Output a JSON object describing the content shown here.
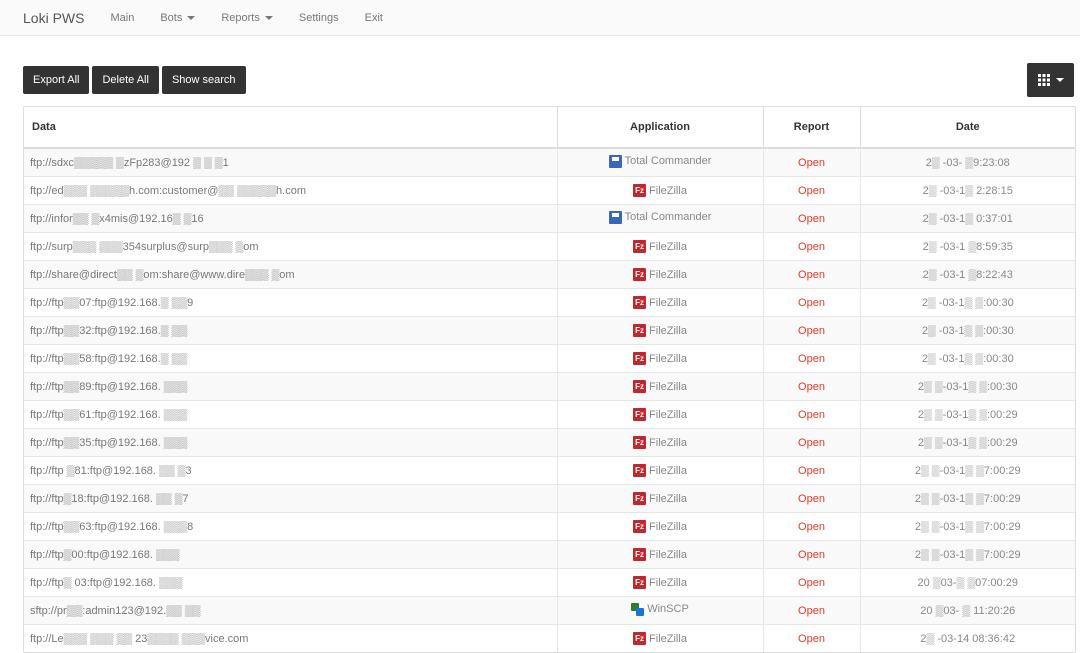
{
  "nav": {
    "brand": "Loki PWS",
    "items": [
      {
        "label": "Main",
        "dropdown": false
      },
      {
        "label": "Bots",
        "dropdown": true
      },
      {
        "label": "Reports",
        "dropdown": true
      },
      {
        "label": "Settings",
        "dropdown": false
      },
      {
        "label": "Exit",
        "dropdown": false
      }
    ]
  },
  "toolbar": {
    "export_all": "Export All",
    "delete_all": "Delete All",
    "show_search": "Show search"
  },
  "grid_button": {
    "icon": "grid-icon"
  },
  "table": {
    "headers": {
      "data": "Data",
      "application": "Application",
      "report": "Report",
      "date": "Date"
    },
    "report_link": "Open",
    "rows": [
      {
        "data": "ftp://sdxc▒▒▒▒▒ ▒zFp283@192 ▒ ▒ ▒1",
        "app": "Total Commander",
        "icon": "total-commander",
        "date": "2▒ -03- ▒9:23:08"
      },
      {
        "data": "ftp://ed▒▒▒ ▒▒▒▒▒h.com:customer@▒▒ ▒▒▒▒▒h.com",
        "app": "FileZilla",
        "icon": "filezilla",
        "date": "2▒ -03-1▒ 2:28:15"
      },
      {
        "data": "ftp://infor▒▒ ▒x4mis@192.16▒ ▒16",
        "app": "Total Commander",
        "icon": "total-commander",
        "date": "2▒ -03-1▒ 0:37:01"
      },
      {
        "data": "ftp://surp▒▒▒ ▒▒▒354surplus@surp▒▒▒ ▒om",
        "app": "FileZilla",
        "icon": "filezilla",
        "date": "2▒ -03-1 ▒8:59:35"
      },
      {
        "data": "ftp://share@direct▒▒ ▒om:share@www.dire▒▒▒ ▒om",
        "app": "FileZilla",
        "icon": "filezilla",
        "date": "2▒ -03-1 ▒8:22:43"
      },
      {
        "data": "ftp://ftp▒▒07:ftp@192.168.▒ ▒▒9",
        "app": "FileZilla",
        "icon": "filezilla",
        "date": "2▒ -03-1▒ ▒:00:30"
      },
      {
        "data": "ftp://ftp▒▒32:ftp@192.168.▒ ▒▒",
        "app": "FileZilla",
        "icon": "filezilla",
        "date": "2▒ -03-1▒ ▒:00:30"
      },
      {
        "data": "ftp://ftp▒▒58:ftp@192.168.▒ ▒▒",
        "app": "FileZilla",
        "icon": "filezilla",
        "date": "2▒ -03-1▒ ▒:00:30"
      },
      {
        "data": "ftp://ftp▒▒89:ftp@192.168. ▒▒▒",
        "app": "FileZilla",
        "icon": "filezilla",
        "date": "2▒ ▒-03-1▒ ▒:00:30"
      },
      {
        "data": "ftp://ftp▒▒61:ftp@192.168. ▒▒▒",
        "app": "FileZilla",
        "icon": "filezilla",
        "date": "2▒ ▒-03-1▒ ▒:00:29"
      },
      {
        "data": "ftp://ftp▒▒35:ftp@192.168. ▒▒▒",
        "app": "FileZilla",
        "icon": "filezilla",
        "date": "2▒ ▒-03-1▒ ▒:00:29"
      },
      {
        "data": "ftp://ftp ▒81:ftp@192.168. ▒▒ ▒3",
        "app": "FileZilla",
        "icon": "filezilla",
        "date": "2▒ ▒-03-1▒ ▒7:00:29"
      },
      {
        "data": "ftp://ftp▒18:ftp@192.168. ▒▒ ▒7",
        "app": "FileZilla",
        "icon": "filezilla",
        "date": "2▒ ▒-03-1▒ ▒7:00:29"
      },
      {
        "data": "ftp://ftp▒▒63:ftp@192.168. ▒▒▒8",
        "app": "FileZilla",
        "icon": "filezilla",
        "date": "2▒ ▒-03-1▒ ▒7:00:29"
      },
      {
        "data": "ftp://ftp▒00:ftp@192.168. ▒▒▒",
        "app": "FileZilla",
        "icon": "filezilla",
        "date": "2▒ ▒-03-1▒ ▒7:00:29"
      },
      {
        "data": "ftp://ftp▒ 03:ftp@192.168. ▒▒▒",
        "app": "FileZilla",
        "icon": "filezilla",
        "date": "20 ▒03-▒ ▒07:00:29"
      },
      {
        "data": "sftp://pr▒▒:admin123@192.▒▒ ▒▒",
        "app": "WinSCP",
        "icon": "winscp",
        "date": "20 ▒03- ▒ 11:20:26"
      },
      {
        "data": "ftp://Le▒▒▒ ▒▒▒ ▒▒ 23▒▒▒▒ ▒▒▒vice.com",
        "app": "FileZilla",
        "icon": "filezilla",
        "date": "2▒ -03-14 08:36:42"
      }
    ]
  }
}
